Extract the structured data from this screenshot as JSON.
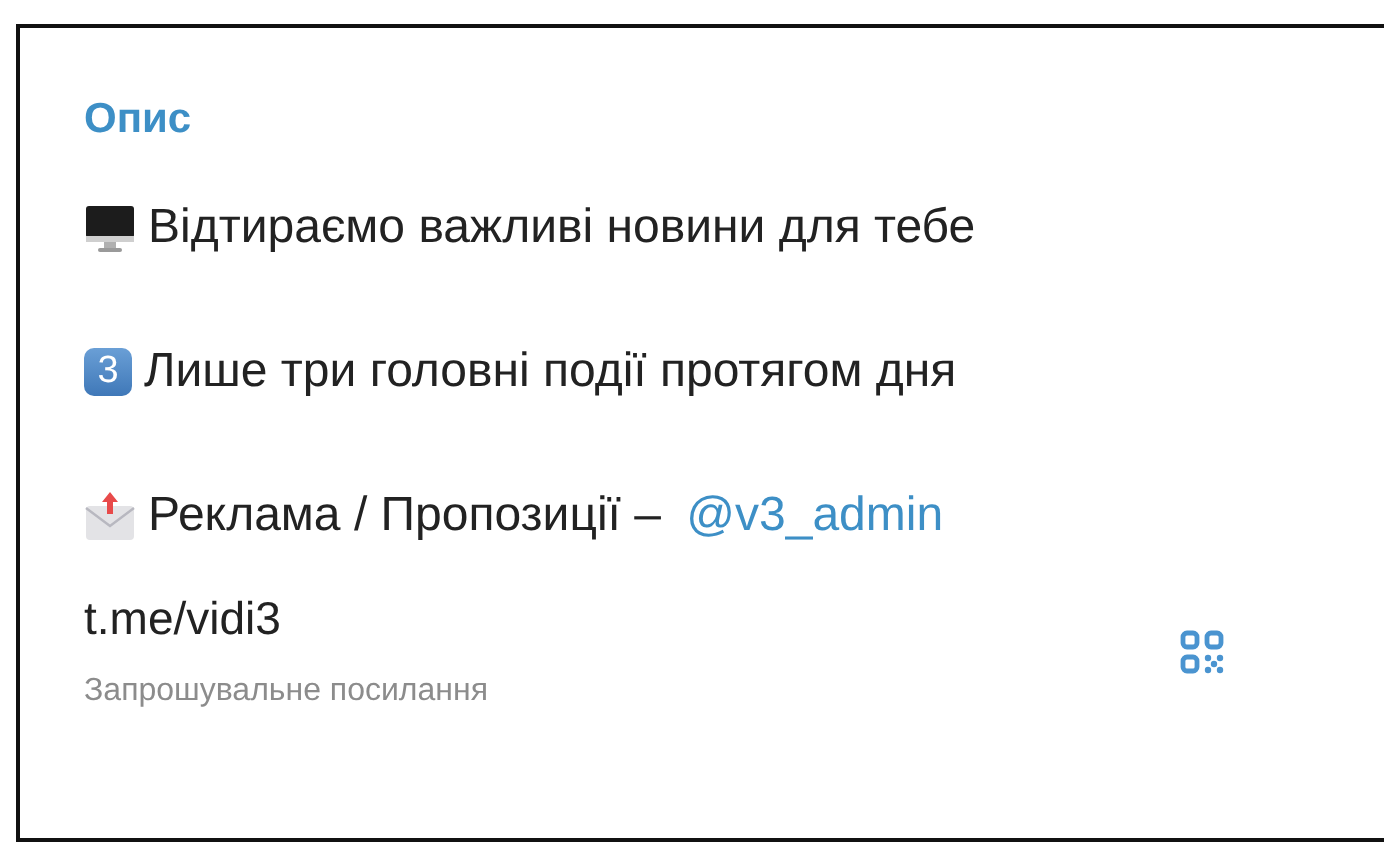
{
  "section_title": "Опис",
  "description_lines": [
    {
      "kind": "monitor",
      "text": "Відтираємо важливі новини для тебе"
    },
    {
      "kind": "keycap",
      "keycap": "3",
      "text": "Лише три головні події протягом дня"
    },
    {
      "kind": "envelope",
      "text": "Реклама / Пропозиції – ",
      "link": "@v3_admin"
    }
  ],
  "invite": {
    "link": "t.me/vidi3",
    "caption": "Запрошувальне посилання"
  }
}
